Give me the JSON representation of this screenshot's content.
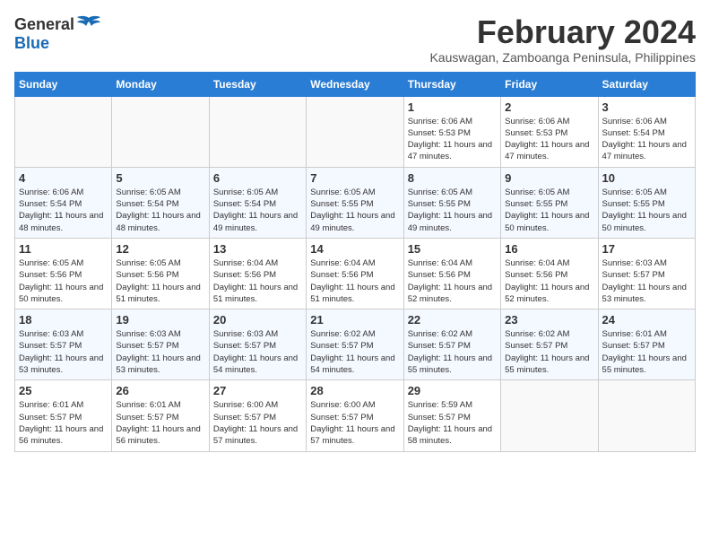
{
  "logo": {
    "general": "General",
    "blue": "Blue"
  },
  "title": "February 2024",
  "subtitle": "Kauswagan, Zamboanga Peninsula, Philippines",
  "days_of_week": [
    "Sunday",
    "Monday",
    "Tuesday",
    "Wednesday",
    "Thursday",
    "Friday",
    "Saturday"
  ],
  "weeks": [
    [
      {
        "num": "",
        "info": ""
      },
      {
        "num": "",
        "info": ""
      },
      {
        "num": "",
        "info": ""
      },
      {
        "num": "",
        "info": ""
      },
      {
        "num": "1",
        "info": "Sunrise: 6:06 AM\nSunset: 5:53 PM\nDaylight: 11 hours and 47 minutes."
      },
      {
        "num": "2",
        "info": "Sunrise: 6:06 AM\nSunset: 5:53 PM\nDaylight: 11 hours and 47 minutes."
      },
      {
        "num": "3",
        "info": "Sunrise: 6:06 AM\nSunset: 5:54 PM\nDaylight: 11 hours and 47 minutes."
      }
    ],
    [
      {
        "num": "4",
        "info": "Sunrise: 6:06 AM\nSunset: 5:54 PM\nDaylight: 11 hours and 48 minutes."
      },
      {
        "num": "5",
        "info": "Sunrise: 6:05 AM\nSunset: 5:54 PM\nDaylight: 11 hours and 48 minutes."
      },
      {
        "num": "6",
        "info": "Sunrise: 6:05 AM\nSunset: 5:54 PM\nDaylight: 11 hours and 49 minutes."
      },
      {
        "num": "7",
        "info": "Sunrise: 6:05 AM\nSunset: 5:55 PM\nDaylight: 11 hours and 49 minutes."
      },
      {
        "num": "8",
        "info": "Sunrise: 6:05 AM\nSunset: 5:55 PM\nDaylight: 11 hours and 49 minutes."
      },
      {
        "num": "9",
        "info": "Sunrise: 6:05 AM\nSunset: 5:55 PM\nDaylight: 11 hours and 50 minutes."
      },
      {
        "num": "10",
        "info": "Sunrise: 6:05 AM\nSunset: 5:55 PM\nDaylight: 11 hours and 50 minutes."
      }
    ],
    [
      {
        "num": "11",
        "info": "Sunrise: 6:05 AM\nSunset: 5:56 PM\nDaylight: 11 hours and 50 minutes."
      },
      {
        "num": "12",
        "info": "Sunrise: 6:05 AM\nSunset: 5:56 PM\nDaylight: 11 hours and 51 minutes."
      },
      {
        "num": "13",
        "info": "Sunrise: 6:04 AM\nSunset: 5:56 PM\nDaylight: 11 hours and 51 minutes."
      },
      {
        "num": "14",
        "info": "Sunrise: 6:04 AM\nSunset: 5:56 PM\nDaylight: 11 hours and 51 minutes."
      },
      {
        "num": "15",
        "info": "Sunrise: 6:04 AM\nSunset: 5:56 PM\nDaylight: 11 hours and 52 minutes."
      },
      {
        "num": "16",
        "info": "Sunrise: 6:04 AM\nSunset: 5:56 PM\nDaylight: 11 hours and 52 minutes."
      },
      {
        "num": "17",
        "info": "Sunrise: 6:03 AM\nSunset: 5:57 PM\nDaylight: 11 hours and 53 minutes."
      }
    ],
    [
      {
        "num": "18",
        "info": "Sunrise: 6:03 AM\nSunset: 5:57 PM\nDaylight: 11 hours and 53 minutes."
      },
      {
        "num": "19",
        "info": "Sunrise: 6:03 AM\nSunset: 5:57 PM\nDaylight: 11 hours and 53 minutes."
      },
      {
        "num": "20",
        "info": "Sunrise: 6:03 AM\nSunset: 5:57 PM\nDaylight: 11 hours and 54 minutes."
      },
      {
        "num": "21",
        "info": "Sunrise: 6:02 AM\nSunset: 5:57 PM\nDaylight: 11 hours and 54 minutes."
      },
      {
        "num": "22",
        "info": "Sunrise: 6:02 AM\nSunset: 5:57 PM\nDaylight: 11 hours and 55 minutes."
      },
      {
        "num": "23",
        "info": "Sunrise: 6:02 AM\nSunset: 5:57 PM\nDaylight: 11 hours and 55 minutes."
      },
      {
        "num": "24",
        "info": "Sunrise: 6:01 AM\nSunset: 5:57 PM\nDaylight: 11 hours and 55 minutes."
      }
    ],
    [
      {
        "num": "25",
        "info": "Sunrise: 6:01 AM\nSunset: 5:57 PM\nDaylight: 11 hours and 56 minutes."
      },
      {
        "num": "26",
        "info": "Sunrise: 6:01 AM\nSunset: 5:57 PM\nDaylight: 11 hours and 56 minutes."
      },
      {
        "num": "27",
        "info": "Sunrise: 6:00 AM\nSunset: 5:57 PM\nDaylight: 11 hours and 57 minutes."
      },
      {
        "num": "28",
        "info": "Sunrise: 6:00 AM\nSunset: 5:57 PM\nDaylight: 11 hours and 57 minutes."
      },
      {
        "num": "29",
        "info": "Sunrise: 5:59 AM\nSunset: 5:57 PM\nDaylight: 11 hours and 58 minutes."
      },
      {
        "num": "",
        "info": ""
      },
      {
        "num": "",
        "info": ""
      }
    ]
  ]
}
